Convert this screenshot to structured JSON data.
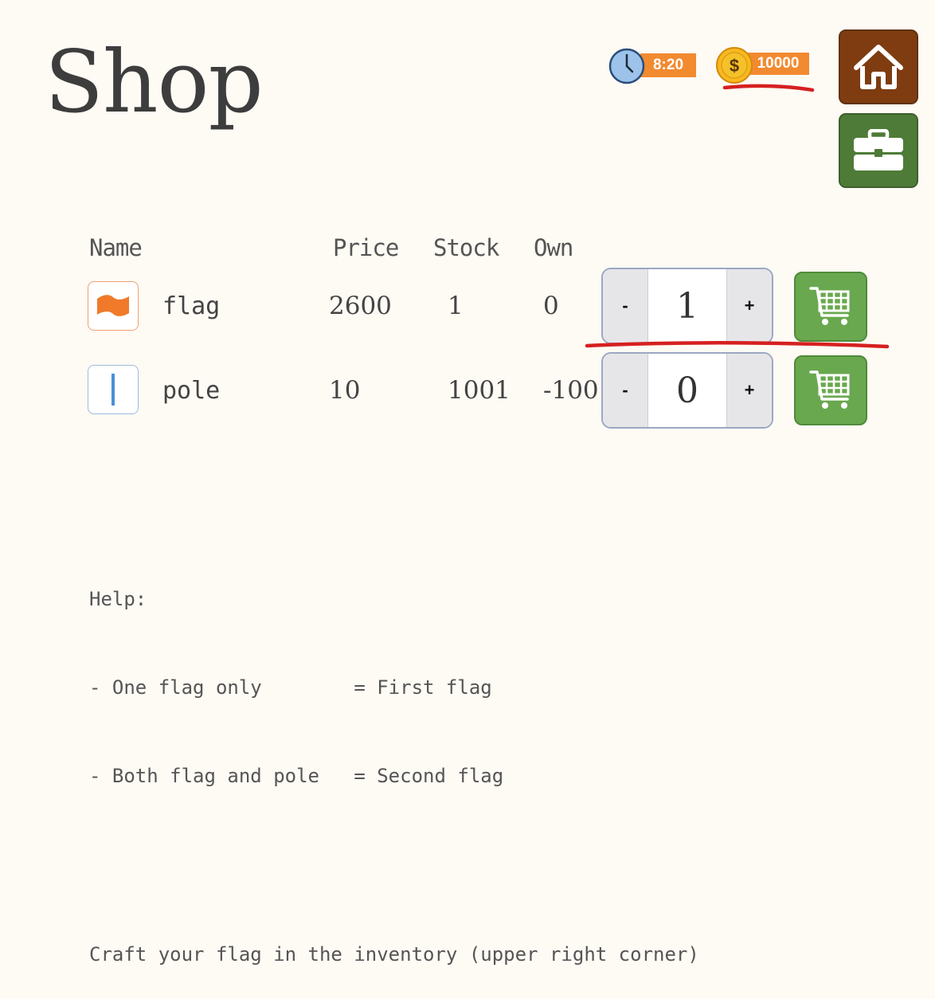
{
  "page": {
    "title": "Shop"
  },
  "hud": {
    "time": "8:20",
    "coins": "10000",
    "time_icon": "clock-icon",
    "coin_icon": "dollar-coin-icon"
  },
  "nav": {
    "home_icon": "home-icon",
    "inventory_icon": "briefcase-icon",
    "home_color": "#7e3c10",
    "inventory_color": "#4e7b37"
  },
  "table": {
    "headers": {
      "name": "Name",
      "price": "Price",
      "stock": "Stock",
      "own": "Own"
    },
    "rows": [
      {
        "name": "flag",
        "price": "2600",
        "stock": "1",
        "own": "0",
        "quantity": "1",
        "icon": "flag-icon"
      },
      {
        "name": "pole",
        "price": "10",
        "stock": "1001",
        "own": "-100",
        "quantity": "0",
        "icon": "pole-icon"
      }
    ],
    "minus_label": "-",
    "plus_label": "+"
  },
  "help": {
    "heading": "Help:",
    "line1": "- One flag only        = First flag",
    "line2": "- Both flag and pole   = Second flag",
    "footer": "Craft your flag in the inventory (upper right corner)"
  },
  "colors": {
    "background": "#fefaf4",
    "badge": "#f28a30",
    "cart": "#6aa84f",
    "annotation": "#d62020"
  }
}
